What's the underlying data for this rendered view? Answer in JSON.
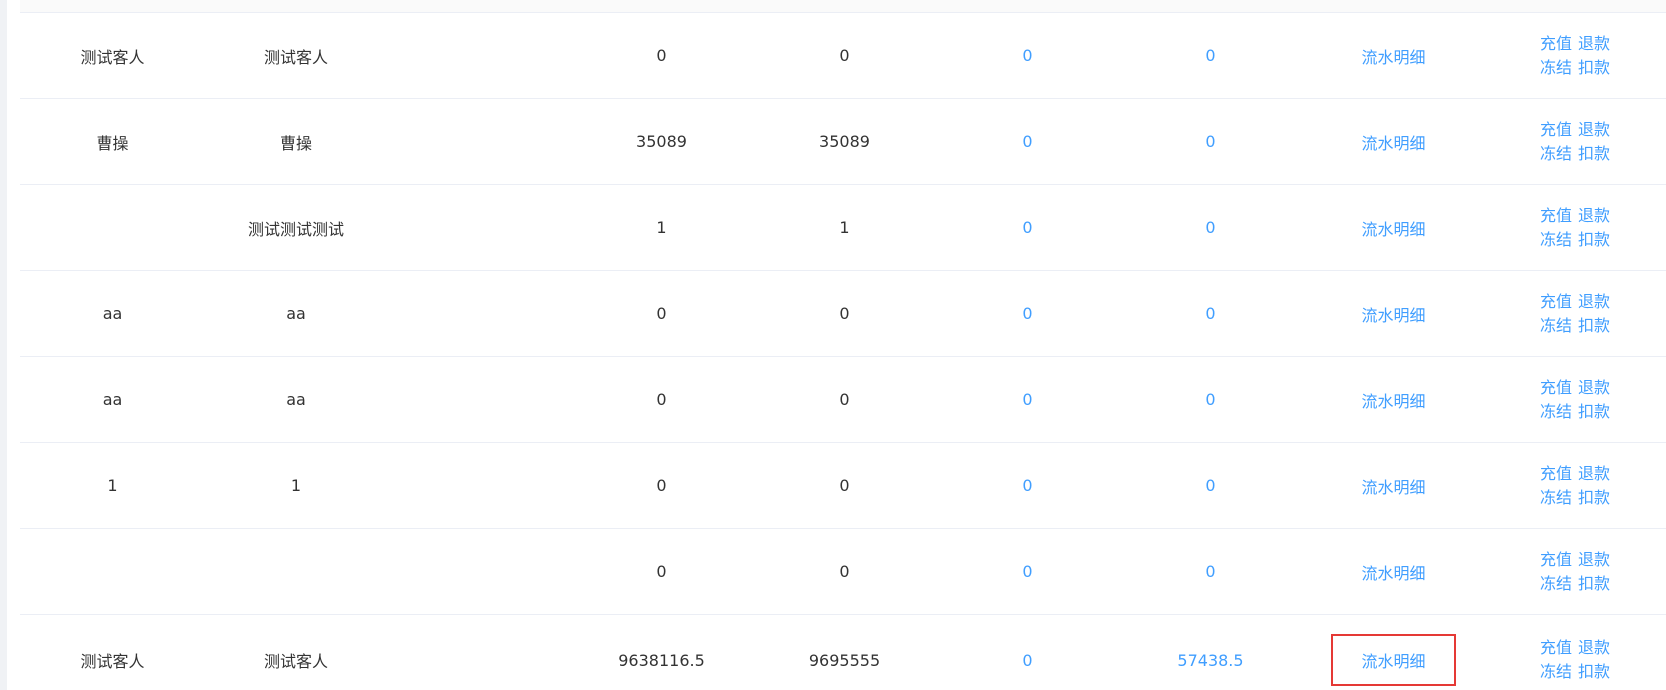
{
  "table": {
    "rows": [
      {
        "col1": "测试客人",
        "col2": "测试客人",
        "col3": "0",
        "col4": "0",
        "col5": "0",
        "col6": "0",
        "flow": "流水明细",
        "actions": [
          "充值",
          "退款",
          "冻结",
          "扣款"
        ]
      },
      {
        "col1": "曹操",
        "col2": "曹操",
        "col3": "35089",
        "col4": "35089",
        "col5": "0",
        "col6": "0",
        "flow": "流水明细",
        "actions": [
          "充值",
          "退款",
          "冻结",
          "扣款"
        ]
      },
      {
        "col1": "",
        "col2": "测试测试测试",
        "col3": "1",
        "col4": "1",
        "col5": "0",
        "col6": "0",
        "flow": "流水明细",
        "actions": [
          "充值",
          "退款",
          "冻结",
          "扣款"
        ]
      },
      {
        "col1": "aa",
        "col2": "aa",
        "col3": "0",
        "col4": "0",
        "col5": "0",
        "col6": "0",
        "flow": "流水明细",
        "actions": [
          "充值",
          "退款",
          "冻结",
          "扣款"
        ]
      },
      {
        "col1": "aa",
        "col2": "aa",
        "col3": "0",
        "col4": "0",
        "col5": "0",
        "col6": "0",
        "flow": "流水明细",
        "actions": [
          "充值",
          "退款",
          "冻结",
          "扣款"
        ]
      },
      {
        "col1": "1",
        "col2": "1",
        "col3": "0",
        "col4": "0",
        "col5": "0",
        "col6": "0",
        "flow": "流水明细",
        "actions": [
          "充值",
          "退款",
          "冻结",
          "扣款"
        ]
      },
      {
        "col1": "",
        "col2": "",
        "col3": "0",
        "col4": "0",
        "col5": "0",
        "col6": "0",
        "flow": "流水明细",
        "actions": [
          "充值",
          "退款",
          "冻结",
          "扣款"
        ]
      },
      {
        "col1": "测试客人",
        "col2": "测试客人",
        "col3": "9638116.5",
        "col4": "9695555",
        "col5": "0",
        "col6": "57438.5",
        "flow": "流水明细",
        "actions": [
          "充值",
          "退款",
          "冻结",
          "扣款"
        ]
      }
    ]
  },
  "colors": {
    "link": "#409eff",
    "highlight": "#e53935",
    "text": "#333333",
    "border": "#ebeef5"
  }
}
